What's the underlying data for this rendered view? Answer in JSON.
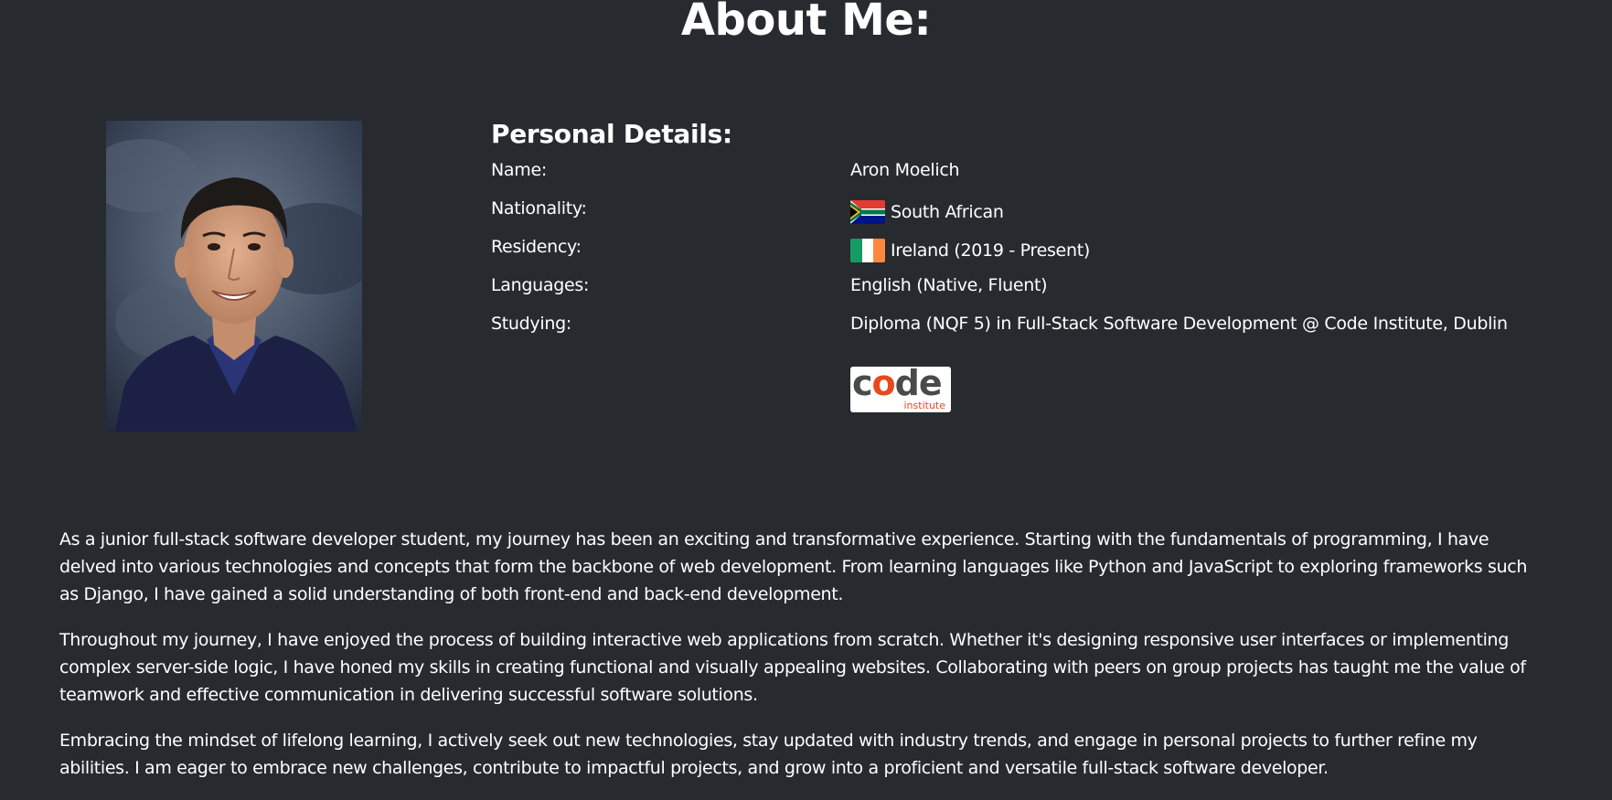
{
  "page": {
    "title": "About Me:"
  },
  "personal_details": {
    "heading": "Personal Details:",
    "rows": [
      {
        "label": "Name:",
        "value": "Aron Moelich"
      },
      {
        "label": "Nationality:",
        "value": "South African",
        "flag_icon": "south-africa-flag-icon"
      },
      {
        "label": "Residency:",
        "value": "Ireland (2019 - Present)",
        "flag_icon": "ireland-flag-icon"
      },
      {
        "label": "Languages:",
        "value": "English (Native, Fluent)"
      },
      {
        "label": "Studying:",
        "value": "Diploma (NQF 5) in Full-Stack Software Development @ Code Institute, Dublin"
      }
    ],
    "logo": {
      "word_prefix": "c",
      "word_accent": "o",
      "word_suffix": "de",
      "subtext": "institute",
      "accent_color": "#e8481b"
    }
  },
  "bio": {
    "paragraphs": [
      "As a junior full-stack software developer student, my journey has been an exciting and transformative experience. Starting with the fundamentals of programming, I have delved into various technologies and concepts that form the backbone of web development. From learning languages like Python and JavaScript to exploring frameworks such as Django, I have gained a solid understanding of both front-end and back-end development.",
      "Throughout my journey, I have enjoyed the process of building interactive web applications from scratch. Whether it's designing responsive user interfaces or implementing complex server-side logic, I have honed my skills in creating functional and visually appealing websites. Collaborating with peers on group projects has taught me the value of teamwork and effective communication in delivering successful software solutions.",
      "Embracing the mindset of lifelong learning, I actively seek out new technologies, stay updated with industry trends, and engage in personal projects to further refine my abilities. I am eager to embrace new challenges, contribute to impactful projects, and grow into a proficient and versatile full-stack software developer."
    ]
  },
  "colors": {
    "background": "#272b30",
    "text": "#ffffff"
  }
}
